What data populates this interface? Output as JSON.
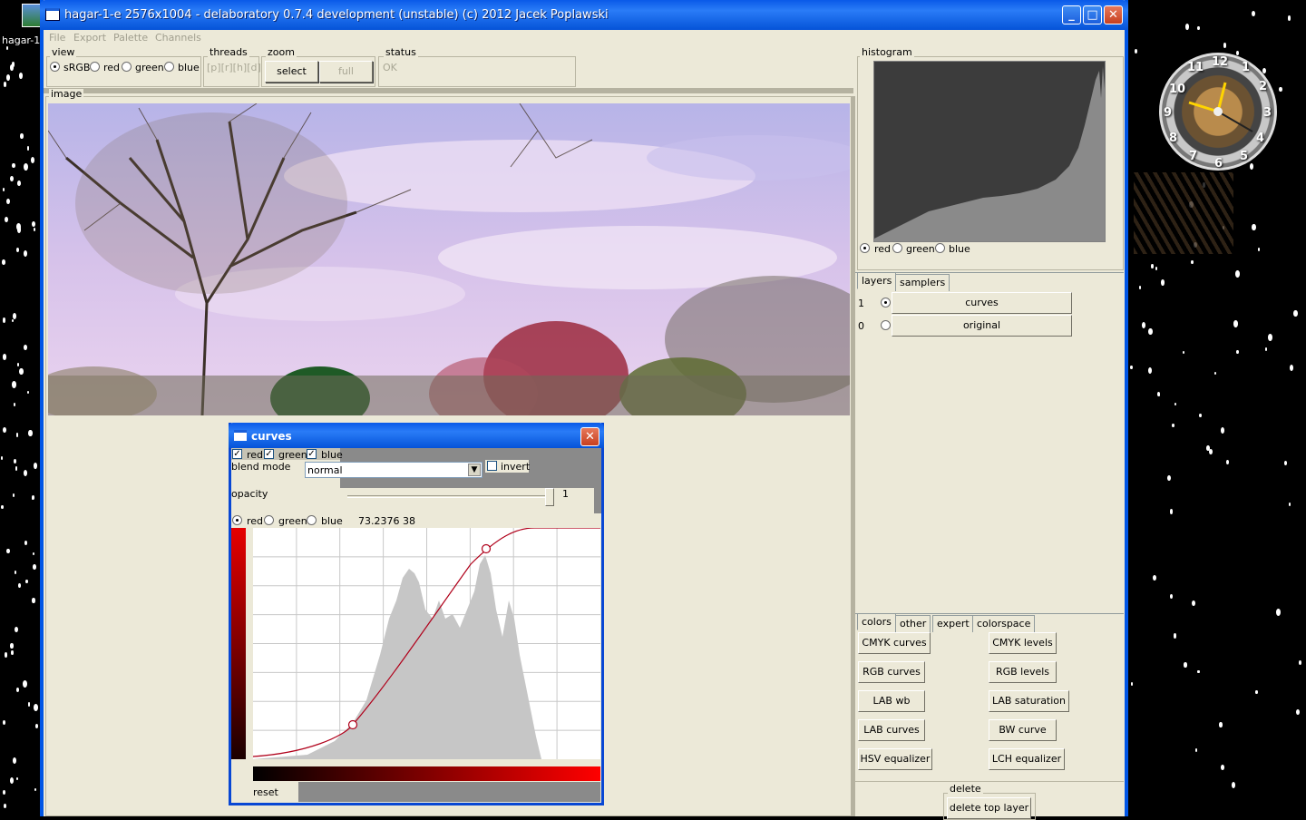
{
  "desktop": {
    "icon_label": "hagar-1-",
    "clock_numbers": [
      "12",
      "1",
      "2",
      "3",
      "4",
      "5",
      "6",
      "7",
      "8",
      "9",
      "10",
      "11"
    ]
  },
  "window": {
    "title": "hagar-1-e 2576x1004 - delaboratory 0.7.4 development (unstable) (c) 2012 Jacek Poplawski",
    "min": "_",
    "max": "□",
    "close": "✕"
  },
  "menu": {
    "file": "File",
    "export": "Export",
    "palette": "Palette",
    "channels": "Channels"
  },
  "view": {
    "label": "view",
    "options": [
      "sRGB",
      "red",
      "green",
      "blue"
    ],
    "selected": "sRGB"
  },
  "threads": {
    "label": "threads",
    "value": "[p][r][h][d]"
  },
  "zoom": {
    "label": "zoom",
    "select": "select",
    "full": "full"
  },
  "status": {
    "label": "status",
    "value": "OK"
  },
  "image_panel": {
    "label": "image"
  },
  "curves": {
    "title": "curves",
    "channels": [
      {
        "name": "red",
        "checked": true
      },
      {
        "name": "green",
        "checked": true
      },
      {
        "name": "blue",
        "checked": true
      }
    ],
    "blend_label": "blend mode",
    "blend_value": "normal",
    "invert_label": "invert",
    "invert_checked": false,
    "opacity_label": "opacity",
    "opacity_value": "1",
    "edit_channels": [
      "red",
      "green",
      "blue"
    ],
    "edit_selected": "red",
    "readout": "73.2376 38",
    "reset": "reset",
    "curve_points": [
      [
        0.29,
        0.85
      ],
      [
        0.67,
        0.09
      ]
    ]
  },
  "histogram": {
    "label": "histogram",
    "channels": [
      "red",
      "green",
      "blue"
    ],
    "selected": "red"
  },
  "layers_tabs": {
    "tab1": "layers",
    "tab2": "samplers",
    "active": "layers"
  },
  "layers": [
    {
      "index": "1",
      "name": "curves",
      "selected": true
    },
    {
      "index": "0",
      "name": "original",
      "selected": false
    }
  ],
  "tools_tabs": {
    "tab1": "colors",
    "tab2": "other",
    "tab3": "expert",
    "tab4": "colorspace",
    "active": "colors"
  },
  "tools": {
    "left": [
      "CMYK curves",
      "RGB curves",
      "LAB wb",
      "LAB curves",
      "HSV equalizer"
    ],
    "right": [
      "CMYK levels",
      "RGB levels",
      "LAB saturation",
      "BW curve",
      "LCH equalizer"
    ]
  },
  "delete": {
    "label": "delete",
    "button": "delete top layer"
  },
  "colors": {
    "title_blue": "#0553d8",
    "accent_red": "#b0001a"
  }
}
